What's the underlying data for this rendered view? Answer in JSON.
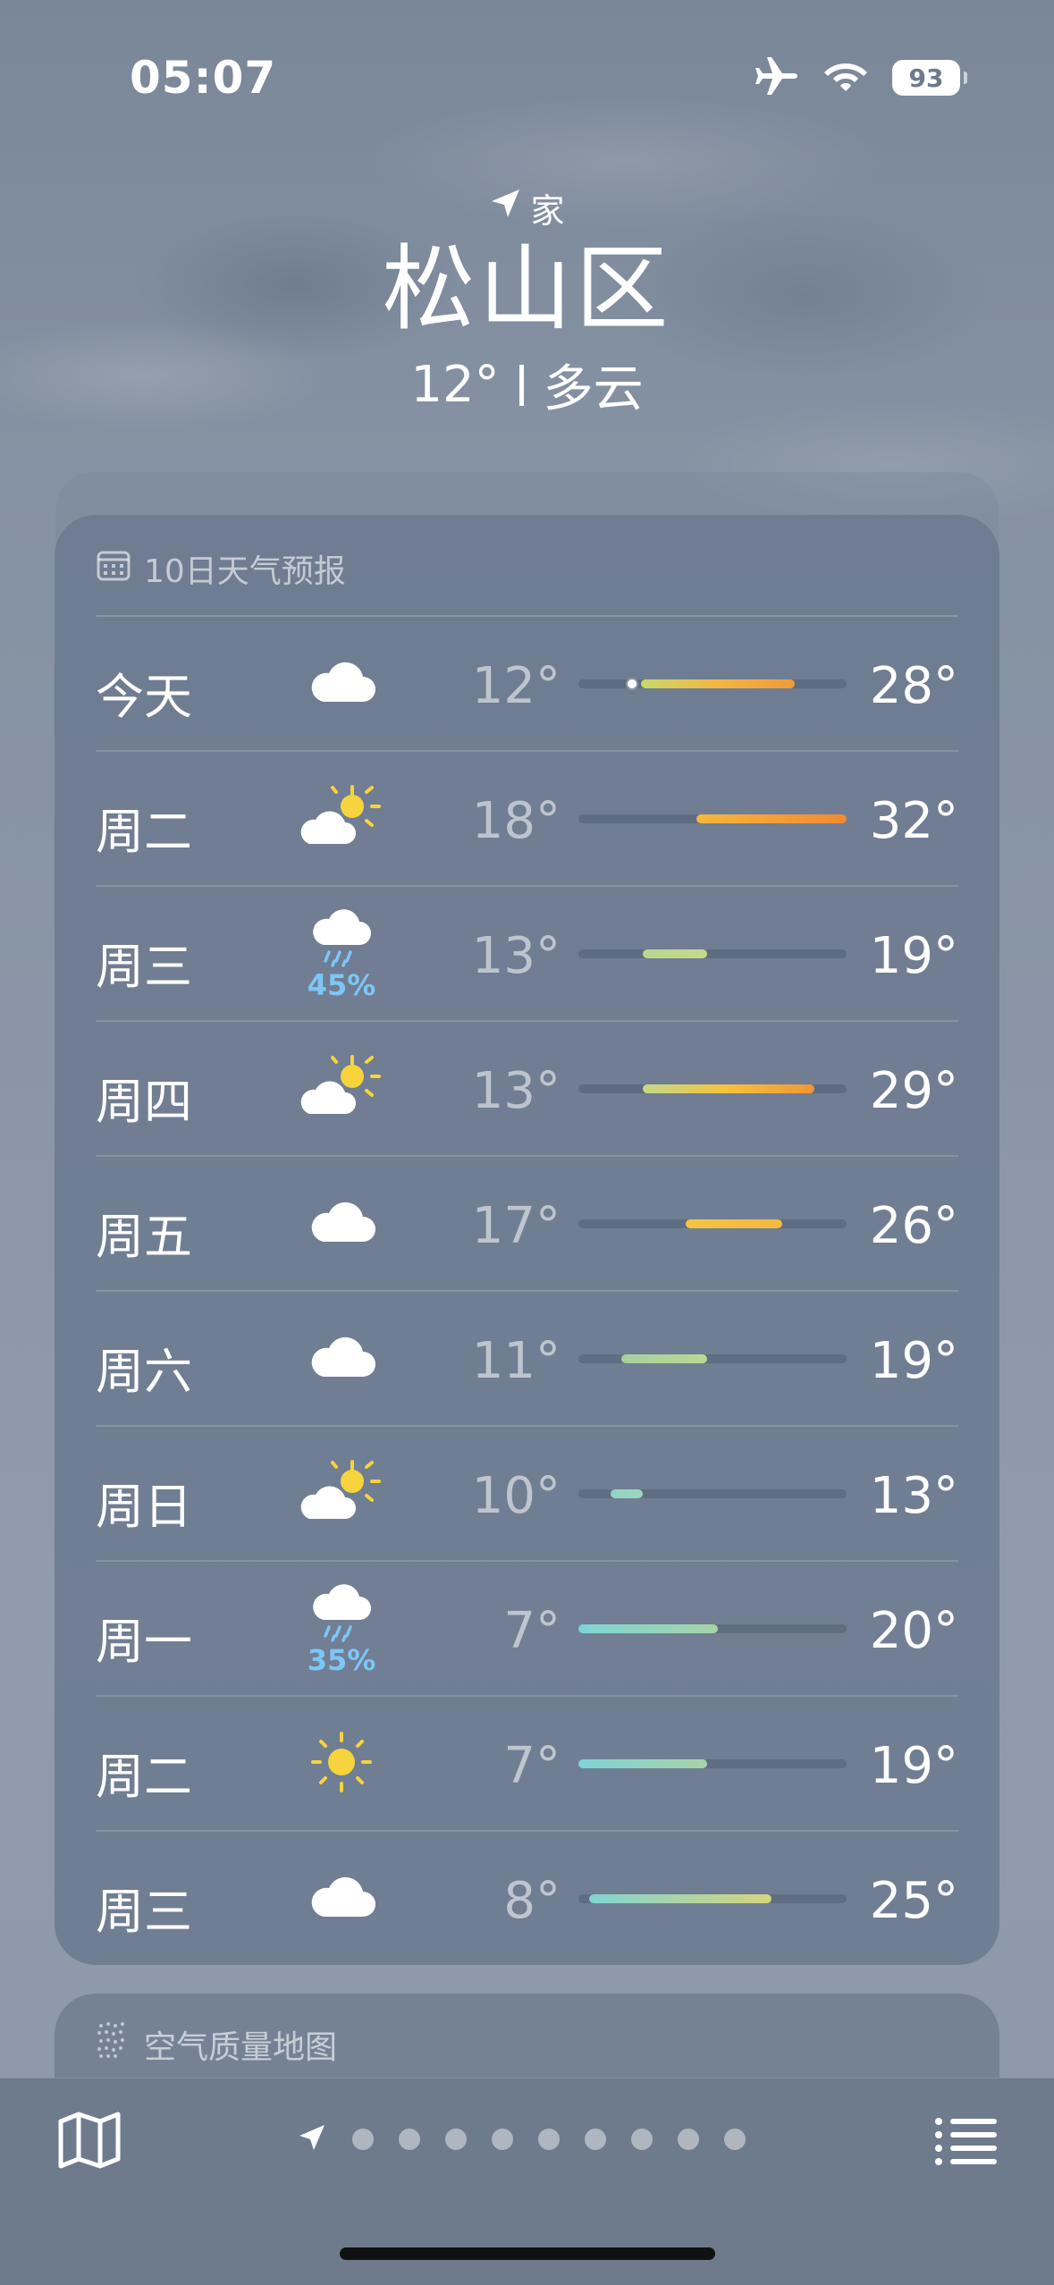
{
  "status_bar": {
    "time": "05:07",
    "battery": "93",
    "icons": [
      "airplane-icon",
      "wifi-icon",
      "battery-icon"
    ]
  },
  "header": {
    "location_label": "家",
    "city": "松山区",
    "temperature": "12°",
    "condition": "多云"
  },
  "forecast": {
    "title": "10日天气预报",
    "range_min": 7,
    "range_max": 32,
    "days": [
      {
        "day": "今天",
        "icon": "cloud-icon",
        "precip": "",
        "low": "12°",
        "high": "28°",
        "low_val": 12,
        "high_val": 28,
        "current_val": 12,
        "colors": [
          "#c8d86a",
          "#f4b740",
          "#f19a38"
        ]
      },
      {
        "day": "周二",
        "icon": "partly-sunny-icon",
        "precip": "",
        "low": "18°",
        "high": "32°",
        "low_val": 18,
        "high_val": 32,
        "colors": [
          "#f5b73c",
          "#f08a32"
        ]
      },
      {
        "day": "周三",
        "icon": "rain-cloud-icon",
        "precip": "45%",
        "low": "13°",
        "high": "19°",
        "low_val": 13,
        "high_val": 19,
        "colors": [
          "#b9d58f",
          "#c4da8a"
        ]
      },
      {
        "day": "周四",
        "icon": "partly-sunny-icon",
        "precip": "",
        "low": "13°",
        "high": "29°",
        "low_val": 13,
        "high_val": 29,
        "colors": [
          "#c5d88a",
          "#f5c13c",
          "#f1953a"
        ]
      },
      {
        "day": "周五",
        "icon": "cloud-icon",
        "precip": "",
        "low": "17°",
        "high": "26°",
        "low_val": 17,
        "high_val": 26,
        "colors": [
          "#f3c443",
          "#f5b840"
        ]
      },
      {
        "day": "周六",
        "icon": "cloud-icon",
        "precip": "",
        "low": "11°",
        "high": "19°",
        "low_val": 11,
        "high_val": 19,
        "colors": [
          "#a3d1a0",
          "#bcd893"
        ]
      },
      {
        "day": "周日",
        "icon": "partly-sunny-icon",
        "precip": "",
        "low": "10°",
        "high": "13°",
        "low_val": 10,
        "high_val": 13,
        "colors": [
          "#8fd3c8",
          "#9ed6bb"
        ]
      },
      {
        "day": "周一",
        "icon": "rain-cloud-icon",
        "precip": "35%",
        "low": "7°",
        "high": "20°",
        "low_val": 7,
        "high_val": 20,
        "colors": [
          "#7ed5d6",
          "#a5d4a6"
        ]
      },
      {
        "day": "周二",
        "icon": "sun-icon",
        "precip": "",
        "low": "7°",
        "high": "19°",
        "low_val": 7,
        "high_val": 19,
        "colors": [
          "#7ed5d6",
          "#a8d3a8"
        ]
      },
      {
        "day": "周三",
        "icon": "cloud-icon",
        "precip": "",
        "low": "8°",
        "high": "25°",
        "low_val": 8,
        "high_val": 25,
        "colors": [
          "#80d5d2",
          "#d6d57a"
        ]
      }
    ]
  },
  "air_quality": {
    "title": "空气质量地图"
  },
  "toolbar": {
    "map_icon": "map-icon",
    "list_icon": "list-icon",
    "page_count": 9,
    "location_arrow": "location-arrow-icon"
  },
  "colors": {
    "card_bg": "#6c7a8f",
    "precip": "#7cc7f6",
    "sun": "#f7d33c"
  }
}
